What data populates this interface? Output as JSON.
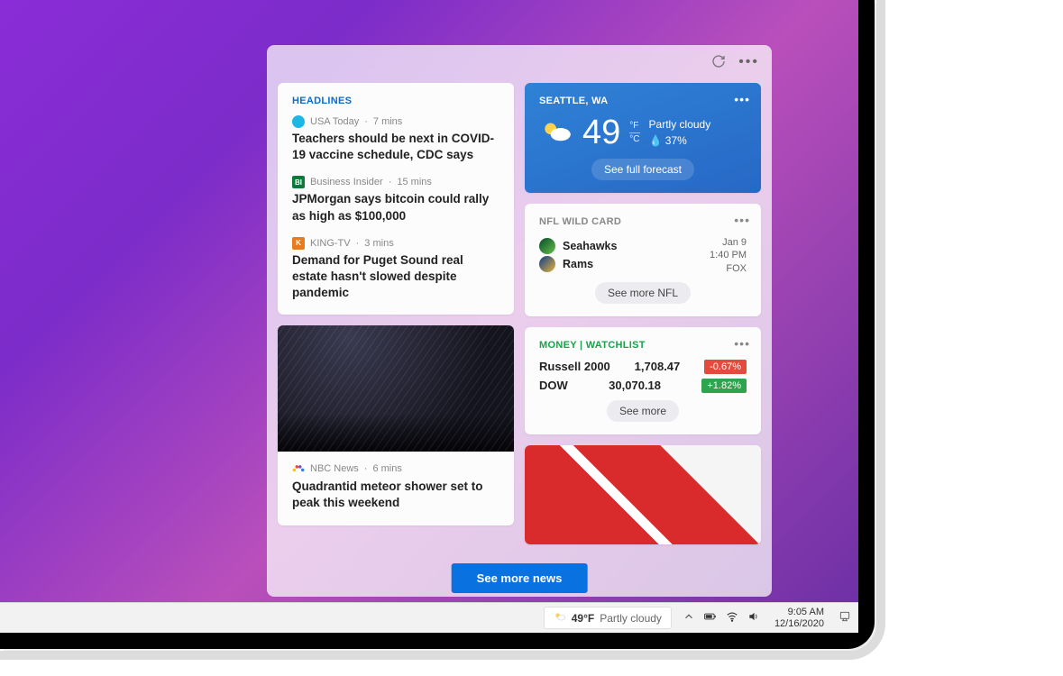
{
  "panel": {
    "headlines": {
      "title": "HEADLINES",
      "items": [
        {
          "source": "USA Today",
          "age": "7 mins",
          "title": "Teachers should be next in COVID-19 vaccine schedule, CDC says",
          "icon_bg": "#1fb6e6",
          "icon_text": ""
        },
        {
          "source": "Business Insider",
          "age": "15 mins",
          "title": "JPMorgan says bitcoin could rally as high as $100,000",
          "icon_bg": "#0d7a3b",
          "icon_text": "BI"
        },
        {
          "source": "KING-TV",
          "age": "3 mins",
          "title": "Demand for Puget Sound real estate hasn't slowed despite pandemic",
          "icon_bg": "#e67b1f",
          "icon_text": "K"
        }
      ]
    },
    "photo_news": {
      "source": "NBC News",
      "age": "6 mins",
      "title": "Quadrantid meteor shower set to peak this weekend"
    },
    "see_more_news": "See more news",
    "weather": {
      "location": "SEATTLE, WA",
      "temp": "49",
      "unit_f": "°F",
      "unit_c": "°C",
      "condition": "Partly cloudy",
      "precip": "37%",
      "forecast_btn": "See full forecast"
    },
    "nfl": {
      "title": "NFL WILD CARD",
      "team1": "Seahawks",
      "team2": "Rams",
      "date": "Jan 9",
      "time": "1:40 PM",
      "network": "FOX",
      "more_btn": "See more NFL"
    },
    "money": {
      "title": "MONEY | WATCHLIST",
      "rows": [
        {
          "name": "Russell 2000",
          "price": "1,708.47",
          "change": "-0.67%",
          "dir": "down"
        },
        {
          "name": "DOW",
          "price": "30,070.18",
          "change": "+1.82%",
          "dir": "up"
        }
      ],
      "more_btn": "See more"
    }
  },
  "taskbar": {
    "temp": "49°F",
    "condition": "Partly cloudy",
    "time": "9:05 AM",
    "date": "12/16/2020"
  }
}
